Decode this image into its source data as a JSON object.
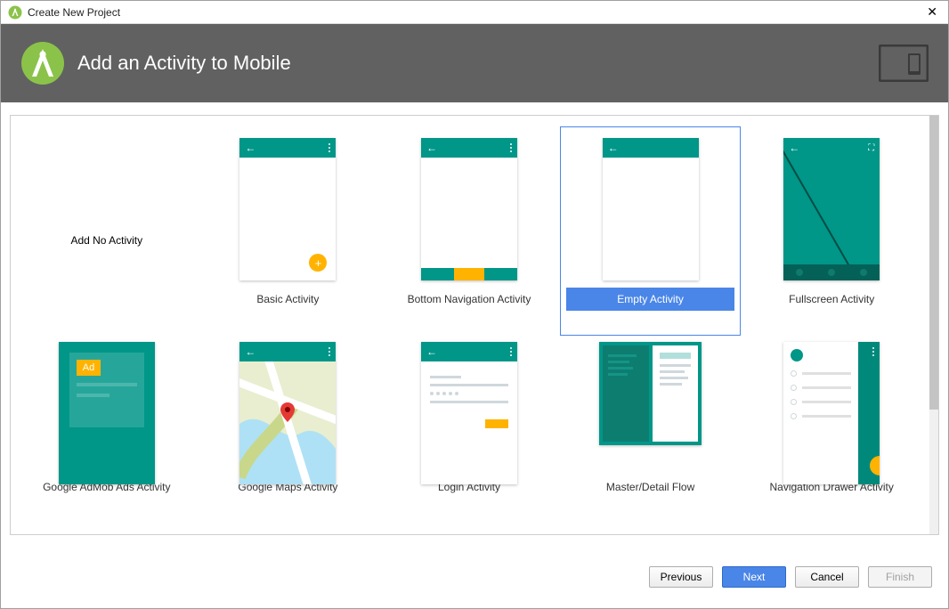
{
  "window": {
    "title": "Create New Project"
  },
  "header": {
    "title": "Add an Activity to Mobile"
  },
  "templates": [
    {
      "id": "none",
      "label": "Add No Activity",
      "selected": false
    },
    {
      "id": "basic",
      "label": "Basic Activity",
      "selected": false
    },
    {
      "id": "bottom",
      "label": "Bottom Navigation Activity",
      "selected": false
    },
    {
      "id": "empty",
      "label": "Empty Activity",
      "selected": true
    },
    {
      "id": "full",
      "label": "Fullscreen Activity",
      "selected": false
    },
    {
      "id": "admob",
      "label": "Google AdMob Ads Activity",
      "selected": false
    },
    {
      "id": "maps",
      "label": "Google Maps Activity",
      "selected": false
    },
    {
      "id": "login",
      "label": "Login Activity",
      "selected": false
    },
    {
      "id": "master",
      "label": "Master/Detail Flow",
      "selected": false
    },
    {
      "id": "drawer",
      "label": "Navigation Drawer Activity",
      "selected": false
    }
  ],
  "admob": {
    "ad_label": "Ad"
  },
  "buttons": {
    "previous": "Previous",
    "next": "Next",
    "cancel": "Cancel",
    "finish": "Finish"
  }
}
